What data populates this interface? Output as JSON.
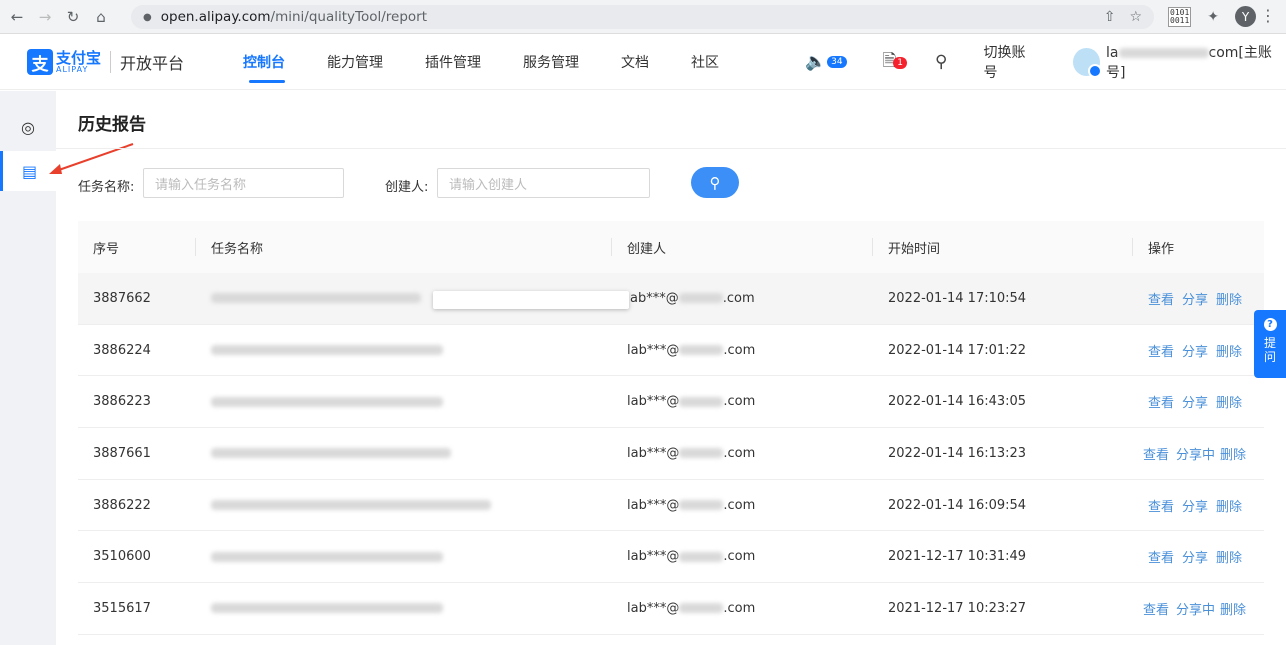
{
  "browser": {
    "url_host": "open.alipay.com",
    "url_path": "/mini/qualityTool/report",
    "profile_initial": "Y",
    "ext_text": "0101\n0011"
  },
  "header": {
    "logo_mark": "支",
    "logo_cn": "支付宝",
    "logo_en": "ALIPAY",
    "platform": "开放平台",
    "menu": [
      "控制台",
      "能力管理",
      "插件管理",
      "服务管理",
      "文档",
      "社区"
    ],
    "notice_count": "34",
    "todo_count": "1",
    "switch_account": "切换账号",
    "user_prefix": "la",
    "user_suffix": "com[主账号]"
  },
  "page": {
    "title": "历史报告",
    "task_name_label": "任务名称:",
    "task_name_placeholder": "请输入任务名称",
    "creator_label": "创建人:",
    "creator_placeholder": "请输入创建人"
  },
  "table": {
    "headers": [
      "序号",
      "任务名称",
      "创建人",
      "开始时间",
      "操作"
    ],
    "rows": [
      {
        "id": "3887662",
        "creator_prefix": "ab***@",
        "creator_suffix": ".com",
        "start": "2022-01-14 17:10:54",
        "actions": [
          "查看",
          "分享",
          "删除"
        ]
      },
      {
        "id": "3886224",
        "creator_prefix": "lab***@",
        "creator_suffix": ".com",
        "start": "2022-01-14 17:01:22",
        "actions": [
          "查看",
          "分享",
          "删除"
        ]
      },
      {
        "id": "3886223",
        "creator_prefix": "lab***@",
        "creator_suffix": ".com",
        "start": "2022-01-14 16:43:05",
        "actions": [
          "查看",
          "分享",
          "删除"
        ]
      },
      {
        "id": "3887661",
        "creator_prefix": "lab***@",
        "creator_suffix": ".com",
        "start": "2022-01-14 16:13:23",
        "actions": [
          "查看",
          "分享中",
          "删除"
        ]
      },
      {
        "id": "3886222",
        "creator_prefix": "lab***@",
        "creator_suffix": ".com",
        "start": "2022-01-14 16:09:54",
        "actions": [
          "查看",
          "分享",
          "删除"
        ]
      },
      {
        "id": "3510600",
        "creator_prefix": "lab***@",
        "creator_suffix": ".com",
        "start": "2021-12-17 10:31:49",
        "actions": [
          "查看",
          "分享",
          "删除"
        ]
      },
      {
        "id": "3515617",
        "creator_prefix": "lab***@",
        "creator_suffix": ".com",
        "start": "2021-12-17 10:23:27",
        "actions": [
          "查看",
          "分享中",
          "删除"
        ]
      }
    ]
  },
  "float_help": {
    "label_1": "提",
    "label_2": "问"
  },
  "colors": {
    "brand": "#1677ff",
    "link": "#4a90d9",
    "badge_red": "#f5222d"
  }
}
